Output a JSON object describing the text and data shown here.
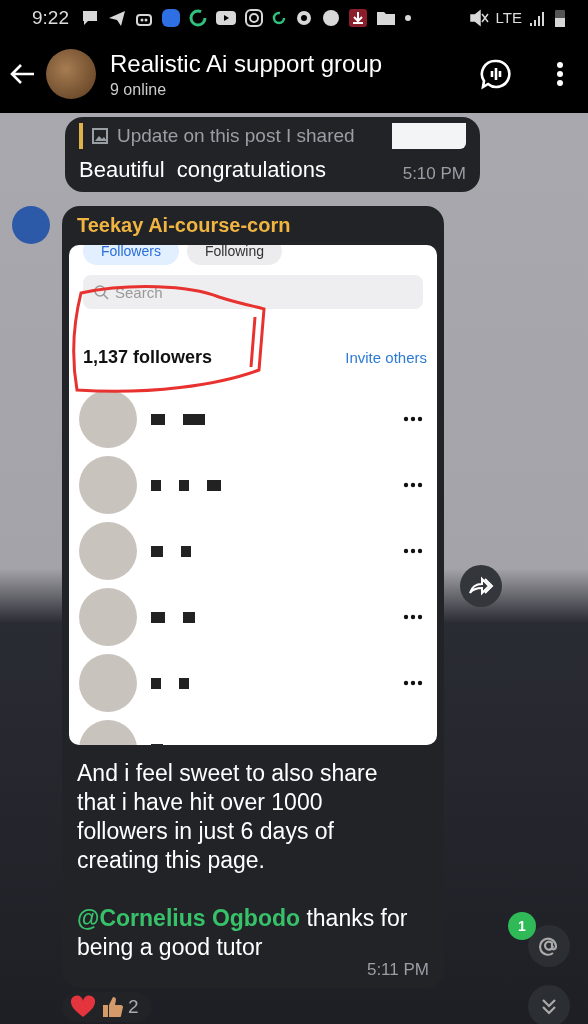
{
  "status_bar": {
    "time": "9:22",
    "network": "LTE"
  },
  "header": {
    "title": "Realistic Ai support group",
    "subtitle": "9 online"
  },
  "messages": [
    {
      "kind": "reply",
      "reply_preview": "Update on this post I shared",
      "text": "Beautiful  congratulations",
      "time": "5:10 PM"
    },
    {
      "kind": "photo",
      "sender": "Teekay Ai-course-corn",
      "screenshot": {
        "tabs": [
          {
            "label": "Followers",
            "selected": true
          },
          {
            "label": "Following",
            "selected": false
          }
        ],
        "search_placeholder": "Search",
        "count": "1,137 followers",
        "invite": "Invite others"
      },
      "text": "And i feel sweet to also share that i have hit over 1000 followers in just 6 days of creating this page.",
      "mention": "@Cornelius Ogbodo",
      "text_after": " thanks for being a good tutor",
      "time": "5:11 PM",
      "reaction_count": "2"
    }
  ],
  "unread_mentions": "1"
}
